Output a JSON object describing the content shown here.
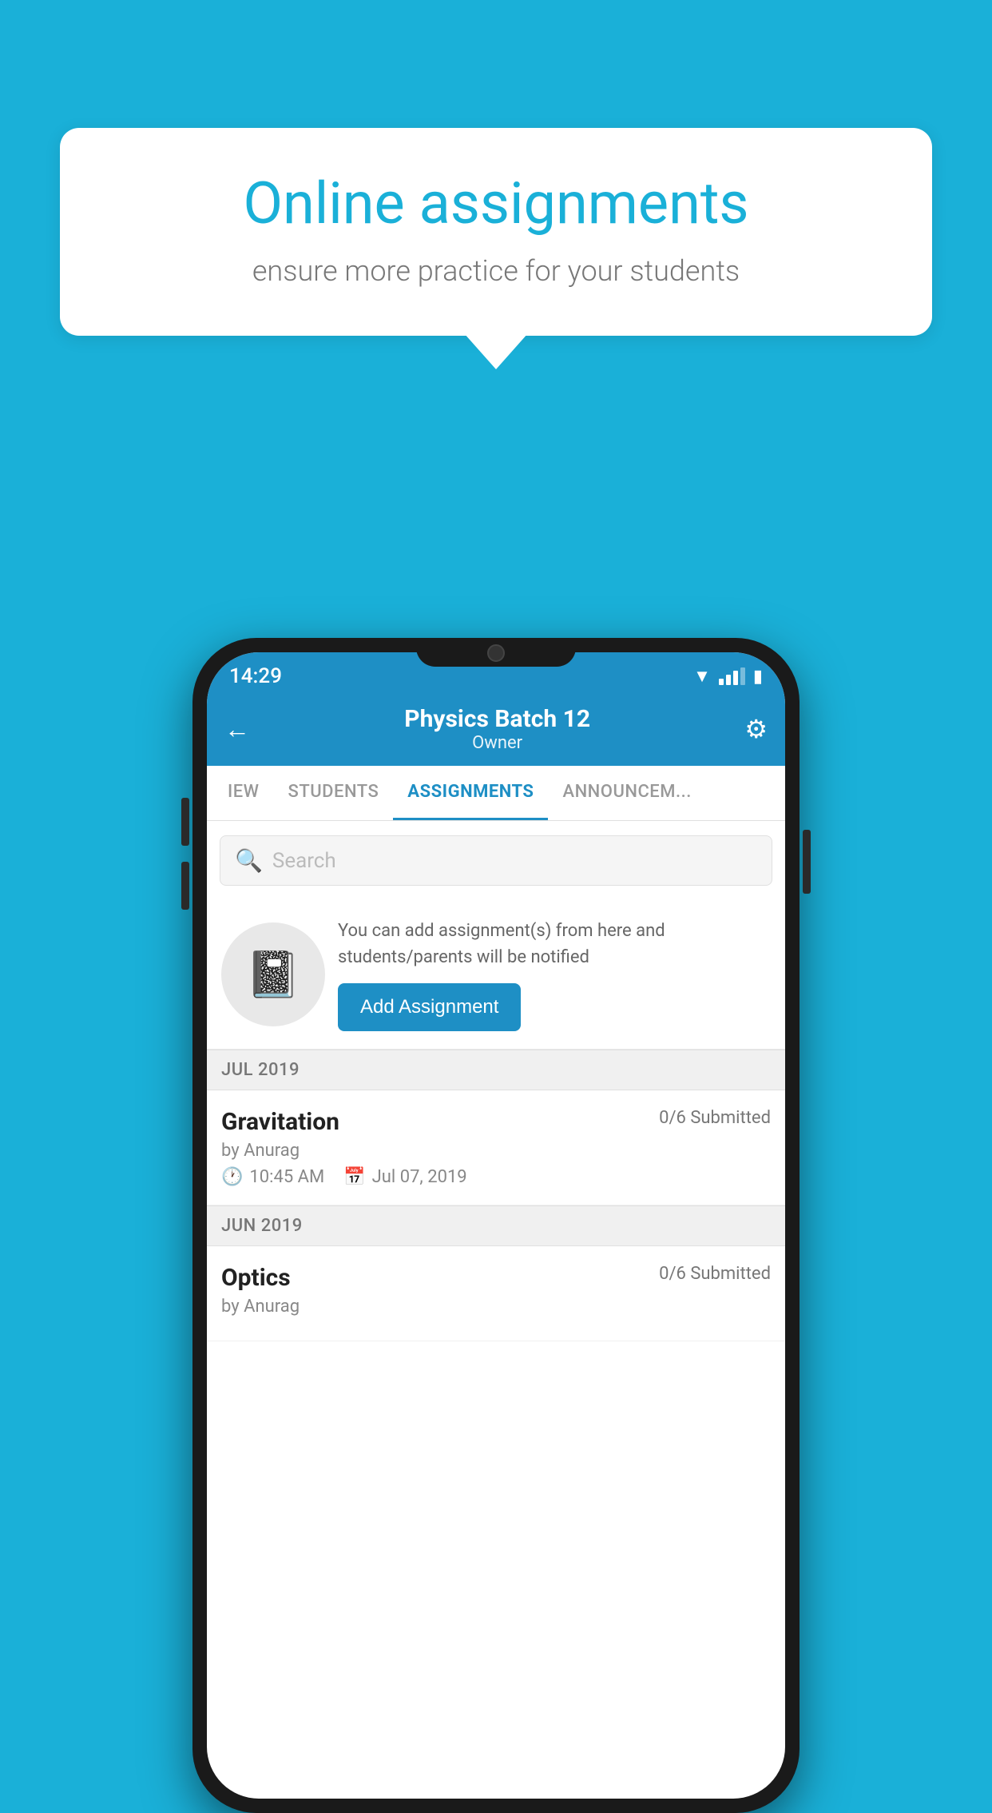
{
  "background": {
    "color": "#1ab0d8"
  },
  "speech_bubble": {
    "title": "Online assignments",
    "subtitle": "ensure more practice for your students"
  },
  "status_bar": {
    "time": "14:29",
    "icons": [
      "wifi",
      "signal",
      "battery"
    ]
  },
  "app_header": {
    "title": "Physics Batch 12",
    "subtitle": "Owner",
    "back_label": "←",
    "gear_label": "⚙"
  },
  "tabs": [
    {
      "label": "IEW",
      "active": false
    },
    {
      "label": "STUDENTS",
      "active": false
    },
    {
      "label": "ASSIGNMENTS",
      "active": true
    },
    {
      "label": "ANNOUNCEM...",
      "active": false
    }
  ],
  "search": {
    "placeholder": "Search"
  },
  "promo": {
    "description": "You can add assignment(s) from here and students/parents will be notified",
    "button_label": "Add Assignment"
  },
  "sections": [
    {
      "month": "JUL 2019",
      "assignments": [
        {
          "name": "Gravitation",
          "submitted": "0/6 Submitted",
          "author": "by Anurag",
          "time": "10:45 AM",
          "date": "Jul 07, 2019"
        }
      ]
    },
    {
      "month": "JUN 2019",
      "assignments": [
        {
          "name": "Optics",
          "submitted": "0/6 Submitted",
          "author": "by Anurag",
          "time": "",
          "date": ""
        }
      ]
    }
  ]
}
